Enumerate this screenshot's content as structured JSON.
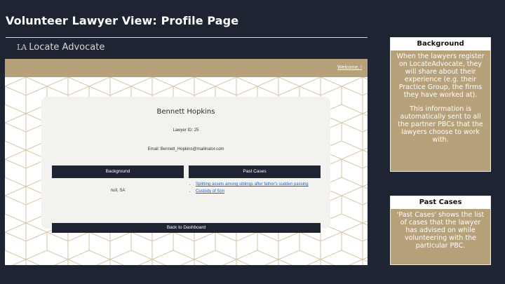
{
  "slide": {
    "title": "Volunteer Lawyer View: Profile Page"
  },
  "app": {
    "logo_mark": "LA",
    "name": "Locate Advocate",
    "welcome": "Welcome, !"
  },
  "profile": {
    "name": "Bennett Hopkins",
    "lawyer_id": "Lawyer ID: 25",
    "email": "Email: Bennett_Hopkins@mailinator.com",
    "background_label": "Background",
    "past_cases_label": "Past Cases",
    "background_value": "null, SA",
    "cases": [
      "Splitting assets among siblings after father's sudden passing",
      "Custody of Son"
    ],
    "back_button": "Back to Dashboard"
  },
  "notes": {
    "background": {
      "title": "Background",
      "text1": "When the lawyers register on LocateAdvocate, they will share about their experience (e.g. their Practice Group, the firms they have worked at).",
      "text2": "This information is automatically sent to all the partner PBCs that the lawyers choose to work with."
    },
    "past_cases": {
      "title": "Past Cases",
      "text": "'Past Cases' shows the list of cases that the lawyer has advised on while volunteering with the particular PBC."
    }
  },
  "colors": {
    "slide_bg": "#1f2433",
    "accent_gold": "#b7a17a",
    "dark_button": "#1f2433",
    "link_blue": "#1a5fd6"
  }
}
